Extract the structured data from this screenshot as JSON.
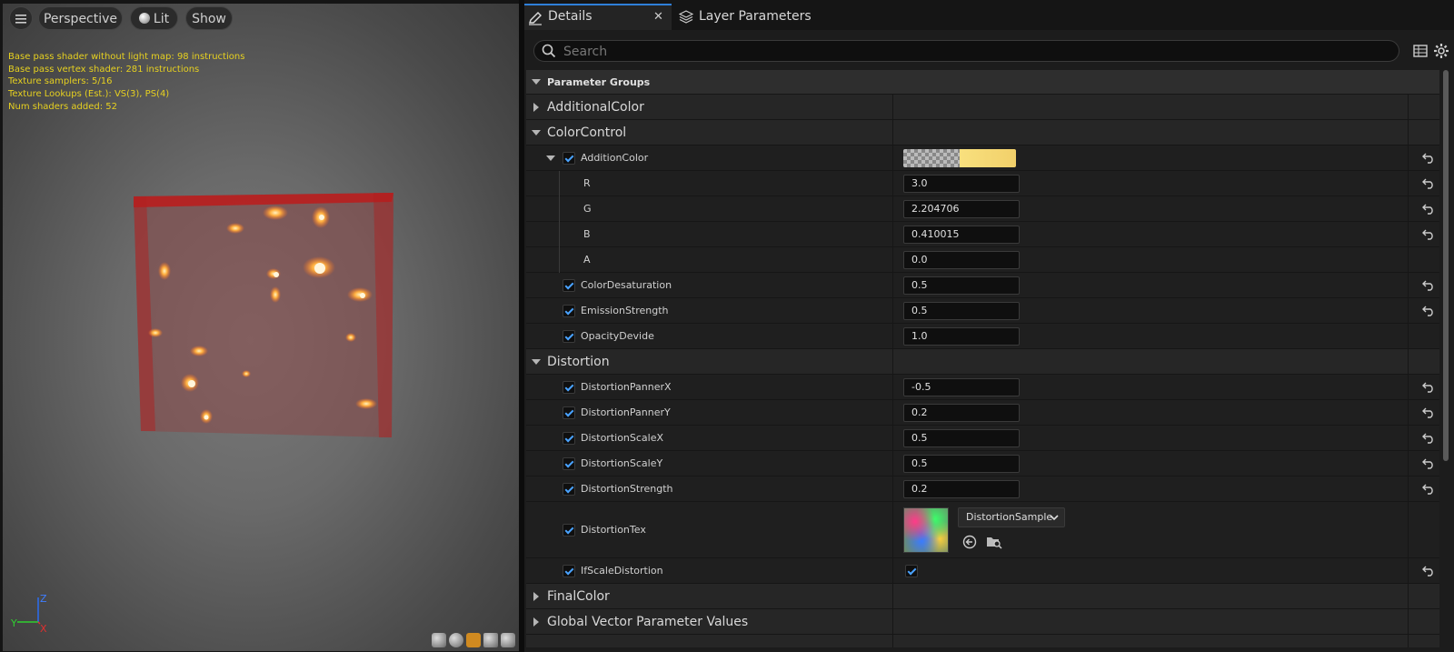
{
  "viewport": {
    "menu_icon": "hamburger-icon",
    "perspective_label": "Perspective",
    "lit_label": "Lit",
    "show_label": "Show",
    "stats": [
      "Base pass shader without light map: 98 instructions",
      "Base pass vertex shader: 281 instructions",
      "Texture samplers: 5/16",
      "Texture Lookups (Est.): VS(3), PS(4)",
      "Num shaders added: 52"
    ],
    "axis": {
      "z": "Z",
      "y": "Y",
      "x": "X"
    }
  },
  "tabs": {
    "details": "Details",
    "layer_parameters": "Layer Parameters"
  },
  "search": {
    "placeholder": "Search"
  },
  "params": {
    "header": "Parameter Groups",
    "additional_color": "AdditionalColor",
    "color_control": "ColorControl",
    "addition_color": "AdditionColor",
    "r_label": "R",
    "r_value": "3.0",
    "g_label": "G",
    "g_value": "2.204706",
    "b_label": "B",
    "b_value": "0.410015",
    "a_label": "A",
    "a_value": "0.0",
    "color_desaturation": "ColorDesaturation",
    "color_desaturation_value": "0.5",
    "emission_strength": "EmissionStrength",
    "emission_strength_value": "0.5",
    "opacity_devide": "OpacityDevide",
    "opacity_devide_value": "1.0",
    "distortion": "Distortion",
    "distortion_panner_x": "DistortionPannerX",
    "distortion_panner_x_value": "-0.5",
    "distortion_panner_y": "DistortionPannerY",
    "distortion_panner_y_value": "0.2",
    "distortion_scale_x": "DistortionScaleX",
    "distortion_scale_x_value": "0.5",
    "distortion_scale_y": "DistortionScaleY",
    "distortion_scale_y_value": "0.5",
    "distortion_strength": "DistortionStrength",
    "distortion_strength_value": "0.2",
    "distortion_tex": "DistortionTex",
    "distortion_tex_asset": "DistortionSample",
    "if_scale_distortion": "IfScaleDistortion",
    "final_color": "FinalColor",
    "global_vector": "Global Vector Parameter Values"
  },
  "colors": {
    "accent": "#2f7fd8",
    "check": "#4aa3ff",
    "stats_text": "#e6d020",
    "swatch": "#f2d06a"
  }
}
